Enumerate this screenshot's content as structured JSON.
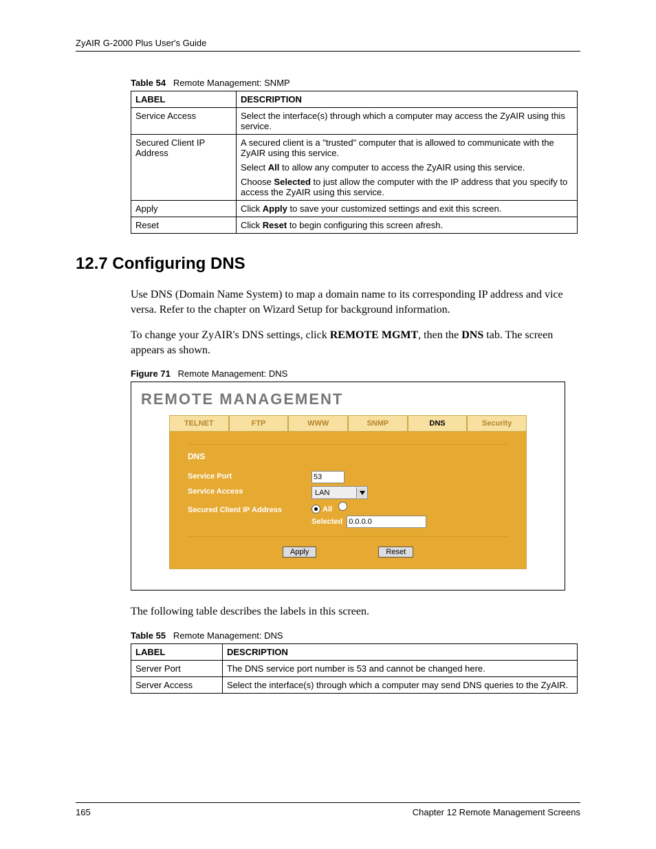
{
  "header": {
    "guide_title": "ZyAIR G-2000 Plus User's Guide"
  },
  "table54": {
    "caption_label": "Table 54",
    "caption_text": "Remote Management: SNMP",
    "col_label": "LABEL",
    "col_desc": "DESCRIPTION",
    "rows": [
      {
        "label": "Service Access",
        "desc": [
          "Select the interface(s) through which a computer may access the ZyAIR using this service."
        ]
      },
      {
        "label": "Secured Client IP Address",
        "desc": [
          "A secured client is a \"trusted\" computer that is allowed to communicate with the ZyAIR using this service.",
          "Select <b>All</b> to allow any computer to access the ZyAIR using this service.",
          "Choose <b>Selected</b> to just allow the computer with the IP address that you specify to access the ZyAIR using this service."
        ]
      },
      {
        "label": "Apply",
        "desc": [
          "Click <b>Apply</b> to save your customized settings and exit this screen."
        ]
      },
      {
        "label": "Reset",
        "desc": [
          "Click <b>Reset</b> to begin configuring this screen afresh."
        ]
      }
    ]
  },
  "section": {
    "heading": "12.7  Configuring DNS",
    "para1": "Use DNS (Domain Name System) to map a domain name to its corresponding IP address and vice versa. Refer to the chapter on Wizard Setup for background information.",
    "para2_pre": "To change your ZyAIR's DNS settings, click ",
    "para2_b1": "REMOTE MGMT",
    "para2_mid": ", then the ",
    "para2_b2": "DNS",
    "para2_post": " tab. The screen appears as shown.",
    "para3": "The following table describes the labels in this screen."
  },
  "figure": {
    "caption_label": "Figure 71",
    "caption_text": "Remote Management: DNS",
    "panel_title": "REMOTE MANAGEMENT",
    "tabs": [
      "TELNET",
      "FTP",
      "WWW",
      "SNMP",
      "DNS",
      "Security"
    ],
    "active_tab": "DNS",
    "group_heading": "DNS",
    "labels": {
      "service_port": "Service Port",
      "service_access": "Service Access",
      "secured_ip": "Secured Client IP Address",
      "all": "All",
      "selected": "Selected"
    },
    "values": {
      "service_port": "53",
      "service_access": "LAN",
      "secured_ip": "0.0.0.0",
      "radio_checked": "all"
    },
    "buttons": {
      "apply": "Apply",
      "reset": "Reset"
    }
  },
  "table55": {
    "caption_label": "Table 55",
    "caption_text": "Remote Management: DNS",
    "col_label": "LABEL",
    "col_desc": "DESCRIPTION",
    "rows": [
      {
        "label": "Server Port",
        "desc": [
          "The DNS service port number is 53 and cannot be changed here."
        ]
      },
      {
        "label": "Server Access",
        "desc": [
          "Select the interface(s) through which a computer may send DNS queries to the ZyAIR."
        ]
      }
    ]
  },
  "footer": {
    "page_number": "165",
    "chapter": "Chapter 12 Remote Management Screens"
  }
}
